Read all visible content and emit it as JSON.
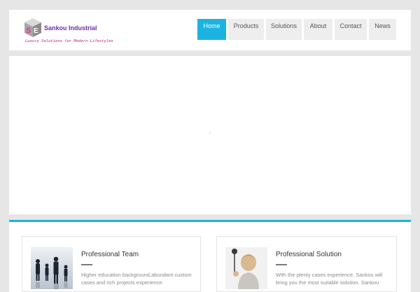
{
  "header": {
    "logo": {
      "name": "Sankou Industrial",
      "tagline": "Luxury Solutions for Modern Lifestyles"
    },
    "nav": [
      {
        "label": "Home",
        "active": true
      },
      {
        "label": "Products",
        "active": false
      },
      {
        "label": "Solutions",
        "active": false
      },
      {
        "label": "About",
        "active": false
      },
      {
        "label": "Contact",
        "active": false
      },
      {
        "label": "News",
        "active": false
      }
    ]
  },
  "colors": {
    "accent": "#1bb4e0",
    "brand_purple": "#6f2da8",
    "brand_pink": "#c0187a",
    "page_background": "#e6e6e6"
  },
  "features": [
    {
      "title": "Professional Team",
      "text": "Higher education background,abundant custom cases and rich projects experience.",
      "image": "team-silhouettes-image"
    },
    {
      "title": "Professional Solution",
      "text": "With the plenty cases experience, Sankou will bring you the most suitable solution. Sankou",
      "image": "child-with-brush-image"
    }
  ]
}
